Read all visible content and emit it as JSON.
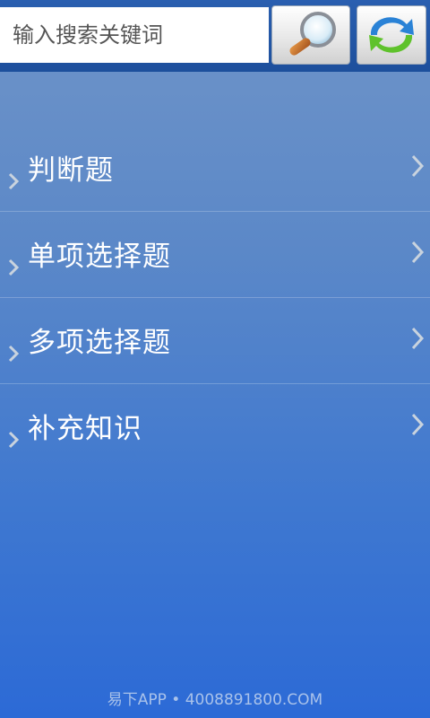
{
  "search": {
    "placeholder": "输入搜索关键词"
  },
  "toolbar": {
    "search_button": "magnifier-search-icon",
    "refresh_button": "refresh-arrows-icon"
  },
  "menu": {
    "items": [
      {
        "label": "判断题"
      },
      {
        "label": "单项选择题"
      },
      {
        "label": "多项选择题"
      },
      {
        "label": "补充知识"
      }
    ]
  },
  "footer": {
    "text": "易下APP • 4008891800.COM"
  },
  "colors": {
    "background": "#5b88c8",
    "topbar": "#1d4f9c",
    "text": "#ffffff",
    "chevron": "#c9d3de"
  }
}
